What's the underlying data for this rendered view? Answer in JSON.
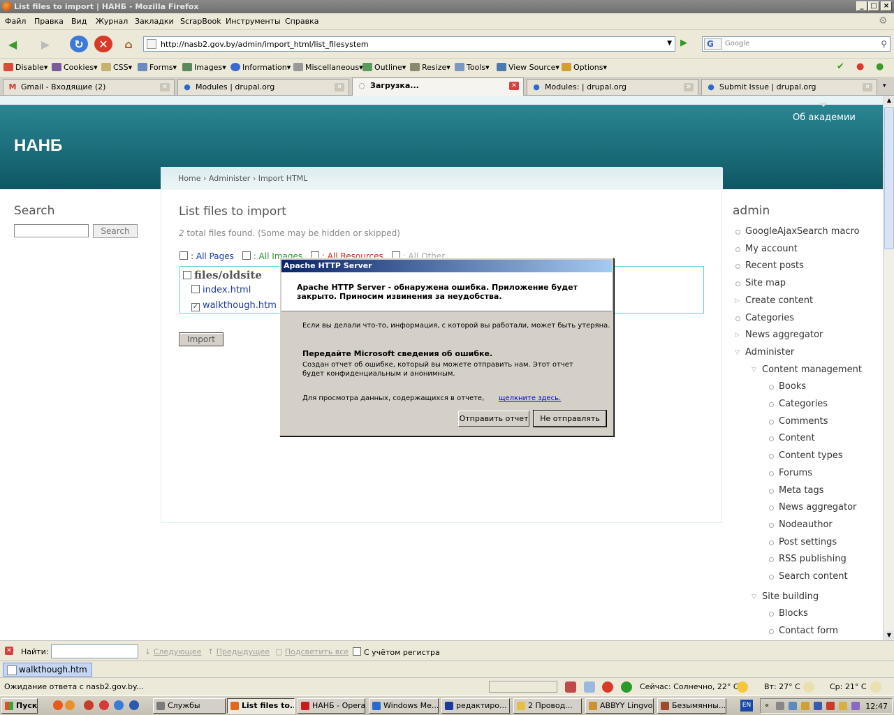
{
  "window": {
    "title": "List files to import | НАНБ - Mozilla Firefox"
  },
  "menu": [
    "Файл",
    "Правка",
    "Вид",
    "Журнал",
    "Закладки",
    "ScrapBook",
    "Инструменты",
    "Справка"
  ],
  "nav": {
    "url": "http://nasb2.gov.by/admin/import_html/list_filesystem",
    "search_placeholder": "Google",
    "search_engine": "G"
  },
  "devtoolbar": [
    "Disable",
    "Cookies",
    "CSS",
    "Forms",
    "Images",
    "Information",
    "Miscellaneous",
    "Outline",
    "Resize",
    "Tools",
    "View Source",
    "Options"
  ],
  "tabs": [
    {
      "label": "Gmail - Входящие (2)",
      "icon": "M"
    },
    {
      "label": "Modules | drupal.org",
      "icon": "●"
    },
    {
      "label": "Загрузка...",
      "icon": "◌"
    },
    {
      "label": "Modules: | drupal.org",
      "icon": "●"
    },
    {
      "label": "Submit Issue | drupal.org",
      "icon": "●"
    }
  ],
  "site": {
    "name": "НАНБ",
    "about_link": "Об академии"
  },
  "breadcrumb": "Home › Administer › Import HTML",
  "page": {
    "title": "List files to import",
    "found_count": "2",
    "found_text": " total files found. (Some may be hidden or skipped)",
    "filters": [
      ": All Pages",
      ": All Images",
      ": All Resources",
      ": All Other"
    ],
    "folder": "files/oldsite",
    "files": [
      {
        "name": "index.html",
        "checked": false
      },
      {
        "name": "walkthough.htm",
        "checked": true
      }
    ],
    "import_button": "Import"
  },
  "left": {
    "title": "Search",
    "button": "Search"
  },
  "right": {
    "title": "admin",
    "items": [
      {
        "label": "GoogleAjaxSearch macro",
        "level": 0,
        "marker": "bullet"
      },
      {
        "label": "My account",
        "level": 0,
        "marker": "bullet"
      },
      {
        "label": "Recent posts",
        "level": 0,
        "marker": "bullet"
      },
      {
        "label": "Site map",
        "level": 0,
        "marker": "bullet"
      },
      {
        "label": "Create content",
        "level": 0,
        "marker": "collapsed"
      },
      {
        "label": "Categories",
        "level": 0,
        "marker": "bullet"
      },
      {
        "label": "News aggregator",
        "level": 0,
        "marker": "collapsed"
      },
      {
        "label": "Administer",
        "level": 0,
        "marker": "expanded"
      },
      {
        "label": "Content management",
        "level": 1,
        "marker": "expanded"
      },
      {
        "label": "Books",
        "level": 2,
        "marker": "bullet"
      },
      {
        "label": "Categories",
        "level": 2,
        "marker": "bullet"
      },
      {
        "label": "Comments",
        "level": 2,
        "marker": "bullet"
      },
      {
        "label": "Content",
        "level": 2,
        "marker": "bullet"
      },
      {
        "label": "Content types",
        "level": 2,
        "marker": "bullet"
      },
      {
        "label": "Forums",
        "level": 2,
        "marker": "bullet"
      },
      {
        "label": "Meta tags",
        "level": 2,
        "marker": "bullet"
      },
      {
        "label": "News aggregator",
        "level": 2,
        "marker": "bullet"
      },
      {
        "label": "Nodeauthor",
        "level": 2,
        "marker": "bullet"
      },
      {
        "label": "Post settings",
        "level": 2,
        "marker": "bullet"
      },
      {
        "label": "RSS publishing",
        "level": 2,
        "marker": "bullet"
      },
      {
        "label": "Search content",
        "level": 2,
        "marker": "bullet"
      },
      {
        "label": "Site building",
        "level": 1,
        "marker": "expanded"
      },
      {
        "label": "Blocks",
        "level": 2,
        "marker": "bullet"
      },
      {
        "label": "Contact form",
        "level": 2,
        "marker": "bullet"
      }
    ]
  },
  "dialog": {
    "title": "Apache HTTP Server",
    "heading": "Apache HTTP Server - обнаружена ошибка. Приложение будет закрыто. Приносим извинения за неудобства.",
    "warning": "Если вы делали что-то, информация, с которой вы работали, может быть утеряна.",
    "send_title": "Передайте Microsoft сведения об ошибке.",
    "send_text": "Создан отчет об ошибке, который вы можете отправить нам. Этот отчет будет конфиденциальным и анонимным.",
    "view_text": "Для просмотра данных, содержащихся в отчете,",
    "view_link": "щелкните здесь.",
    "btn_send": "Отправить отчет",
    "btn_dont": "Не отправлять"
  },
  "findbar": {
    "label": "Найти:",
    "next": "Следующее",
    "prev": "Предыдущее",
    "highlight": "Подсветить все",
    "matchcase": "С учётом регистра"
  },
  "download": {
    "file": "walkthough.htm"
  },
  "status": {
    "text": "Ожидание ответа с nasb2.gov.by...",
    "weather_today": "Сейчас: Солнечно, 22° C",
    "weather_tue": "Вт: 27° C",
    "weather_wed": "Ср: 21° C"
  },
  "taskbar": {
    "start": "Пуск",
    "items": [
      {
        "label": "Службы",
        "color": "#7a7a7a"
      },
      {
        "label": "List files to...",
        "color": "#e06a1a"
      },
      {
        "label": "НАНБ - Opera",
        "color": "#cc1a1a"
      },
      {
        "label": "Windows Me...",
        "color": "#2a6ad0"
      },
      {
        "label": "редактиро...",
        "color": "#1a3aa0"
      },
      {
        "label": "2 Провод...",
        "color": "#e8c040"
      },
      {
        "label": "ABBYY Lingvo",
        "color": "#d09030"
      },
      {
        "label": "Безымянны...",
        "color": "#a04a2a"
      }
    ],
    "lang": "EN",
    "clock": "12:47"
  },
  "colors": {
    "header": "#1a6a78",
    "accent_link": "#1a3aa0",
    "dialog_title": "#0a246a"
  }
}
